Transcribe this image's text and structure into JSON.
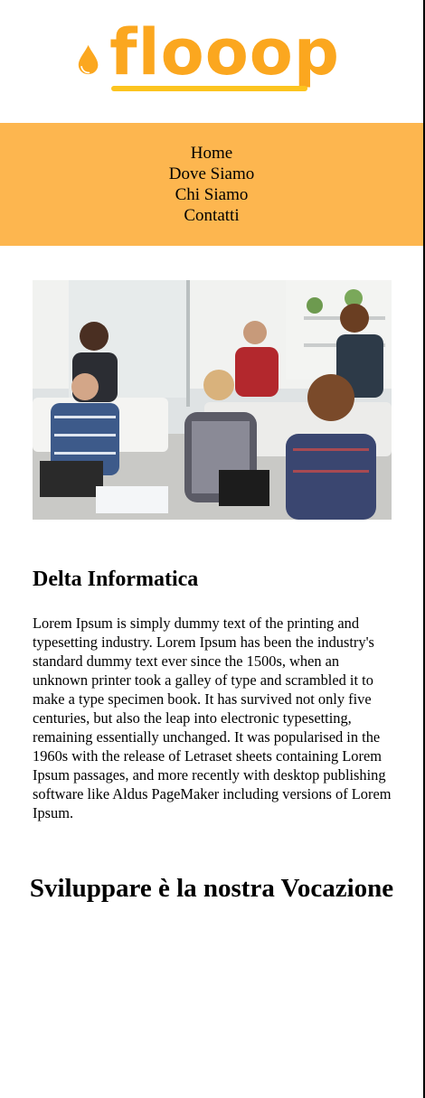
{
  "logo": {
    "text": "flooop",
    "icon": "drop-icon",
    "color": "#fba71f"
  },
  "nav": {
    "background": "#fdb64f",
    "items": [
      {
        "label": "Home"
      },
      {
        "label": "Dove Siamo"
      },
      {
        "label": "Chi Siamo"
      },
      {
        "label": "Contatti"
      }
    ]
  },
  "hero_image": {
    "subject": "team-meeting-photo"
  },
  "section": {
    "title": "Delta Informatica",
    "body": "Lorem Ipsum is simply dummy text of the printing and typesetting industry. Lorem Ipsum has been the industry's standard dummy text ever since the 1500s, when an unknown printer took a galley of type and scrambled it to make a type specimen book. It has survived not only five centuries, but also the leap into electronic typesetting, remaining essentially unchanged. It was popularised in the 1960s with the release of Letraset sheets containing Lorem Ipsum passages, and more recently with desktop publishing software like Aldus PageMaker including versions of Lorem Ipsum."
  },
  "tagline": "Sviluppare è la nostra Vocazione"
}
